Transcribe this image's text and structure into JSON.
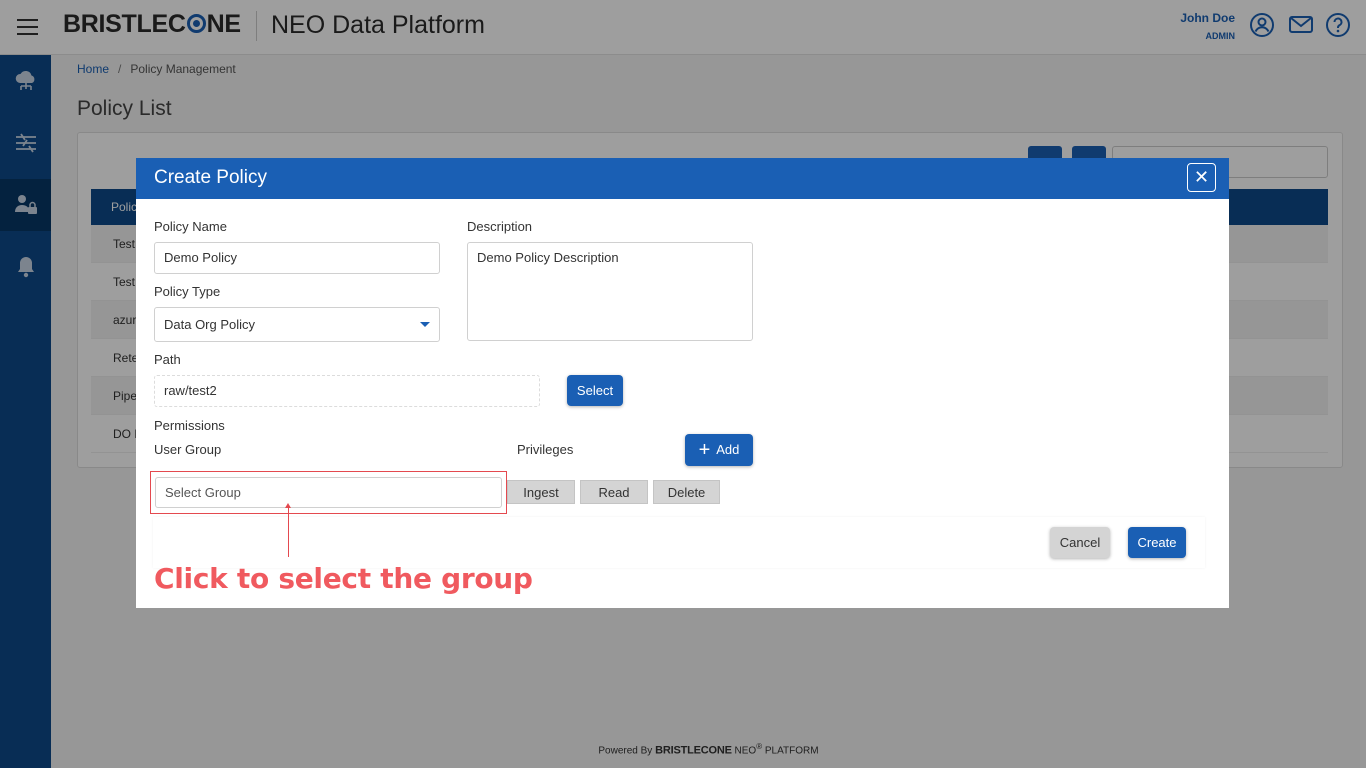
{
  "header": {
    "brand": "BRISTLEC",
    "brand_tail": "NE",
    "app_title": "NEO Data Platform",
    "user_name": "John Doe",
    "user_role": "ADMIN",
    "accent": "#1a5fb4"
  },
  "sidebar": {
    "items": [
      {
        "icon": "cloud-network-icon"
      },
      {
        "icon": "sliders-icon"
      },
      {
        "icon": "user-lock-icon",
        "active": true
      },
      {
        "icon": "bell-icon"
      }
    ]
  },
  "breadcrumb": {
    "home": "Home",
    "separator": "/",
    "current": "Policy Management"
  },
  "page": {
    "title": "Policy List",
    "table_head": "Polic",
    "rows": [
      "Test",
      "Test",
      "azur",
      "Rete",
      "Pipe",
      "DO F"
    ]
  },
  "modal": {
    "title": "Create Policy",
    "close": "✕",
    "policy_name_label": "Policy Name",
    "policy_name_value": "Demo Policy",
    "description_label": "Description",
    "description_value": "Demo Policy Description",
    "policy_type_label": "Policy Type",
    "policy_type_value": "Data Org Policy",
    "path_label": "Path",
    "path_value": "raw/test2",
    "select_button": "Select",
    "permissions_label": "Permissions",
    "user_group_label": "User Group",
    "privileges_label": "Privileges",
    "add_button": "Add",
    "group_placeholder": "Select Group",
    "privileges": [
      "Ingest",
      "Read",
      "Delete"
    ],
    "cancel_button": "Cancel",
    "create_button": "Create"
  },
  "annotation": {
    "text": "Click to select the group",
    "color": "#f05a5f"
  },
  "footer": {
    "powered": "Powered By",
    "brand": "BRISTLECONE",
    "neo": "NEO",
    "reg": "®",
    "platform": "PLATFORM"
  }
}
